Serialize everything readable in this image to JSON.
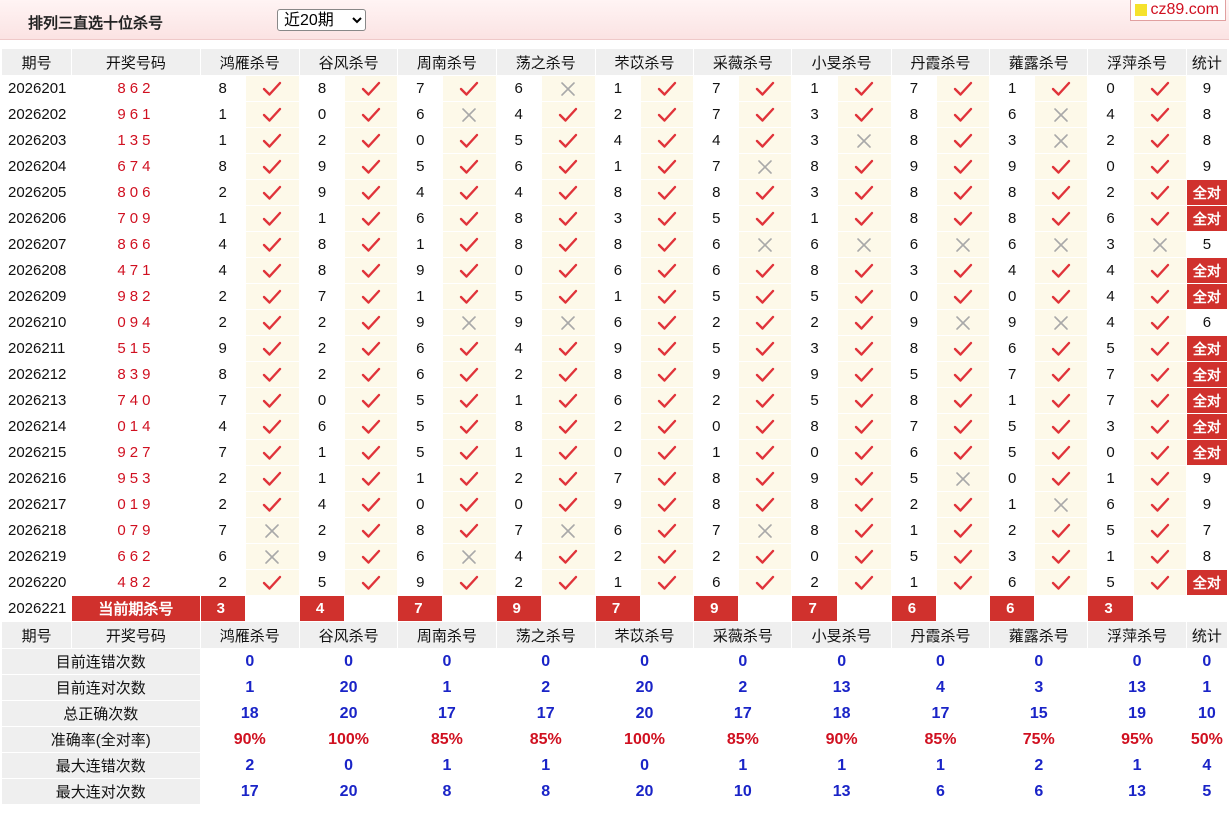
{
  "page": {
    "title": "排列三直选十位杀号",
    "period_selected": "近20期",
    "logo_text": "cz89.com"
  },
  "colors": {
    "accent": "#d0312d",
    "stat_blue": "#1a24c7",
    "stat_red": "#d01020",
    "mark_bg": "#fdf9e9"
  },
  "columns": {
    "issue": "期号",
    "draw": "开奖号码",
    "experts": [
      "鸿雁杀号",
      "谷风杀号",
      "周南杀号",
      "荡之杀号",
      "芣苡杀号",
      "采薇杀号",
      "小旻杀号",
      "丹霞杀号",
      "蕹露杀号",
      "浮萍杀号"
    ],
    "total": "统计"
  },
  "rows": [
    {
      "issue": "2026201",
      "draw": "862",
      "kills": [
        8,
        8,
        7,
        6,
        1,
        7,
        1,
        7,
        1,
        0
      ],
      "hits": [
        1,
        1,
        1,
        0,
        1,
        1,
        1,
        1,
        1,
        1
      ],
      "total": "9"
    },
    {
      "issue": "2026202",
      "draw": "961",
      "kills": [
        1,
        0,
        6,
        4,
        2,
        7,
        3,
        8,
        6,
        4
      ],
      "hits": [
        1,
        1,
        0,
        1,
        1,
        1,
        1,
        1,
        0,
        1
      ],
      "total": "8"
    },
    {
      "issue": "2026203",
      "draw": "135",
      "kills": [
        1,
        2,
        0,
        5,
        4,
        4,
        3,
        8,
        3,
        2
      ],
      "hits": [
        1,
        1,
        1,
        1,
        1,
        1,
        0,
        1,
        0,
        1
      ],
      "total": "8"
    },
    {
      "issue": "2026204",
      "draw": "674",
      "kills": [
        8,
        9,
        5,
        6,
        1,
        7,
        8,
        9,
        9,
        0
      ],
      "hits": [
        1,
        1,
        1,
        1,
        1,
        0,
        1,
        1,
        1,
        1
      ],
      "total": "9"
    },
    {
      "issue": "2026205",
      "draw": "806",
      "kills": [
        2,
        9,
        4,
        4,
        8,
        8,
        3,
        8,
        8,
        2
      ],
      "hits": [
        1,
        1,
        1,
        1,
        1,
        1,
        1,
        1,
        1,
        1
      ],
      "total": "全对"
    },
    {
      "issue": "2026206",
      "draw": "709",
      "kills": [
        1,
        1,
        6,
        8,
        3,
        5,
        1,
        8,
        8,
        6
      ],
      "hits": [
        1,
        1,
        1,
        1,
        1,
        1,
        1,
        1,
        1,
        1
      ],
      "total": "全对"
    },
    {
      "issue": "2026207",
      "draw": "866",
      "kills": [
        4,
        8,
        1,
        8,
        8,
        6,
        6,
        6,
        6,
        3
      ],
      "hits": [
        1,
        1,
        1,
        1,
        1,
        0,
        0,
        0,
        0,
        0
      ],
      "total": "5"
    },
    {
      "issue": "2026208",
      "draw": "471",
      "kills": [
        4,
        8,
        9,
        0,
        6,
        6,
        8,
        3,
        4,
        4
      ],
      "hits": [
        1,
        1,
        1,
        1,
        1,
        1,
        1,
        1,
        1,
        1
      ],
      "total": "全对"
    },
    {
      "issue": "2026209",
      "draw": "982",
      "kills": [
        2,
        7,
        1,
        5,
        1,
        5,
        5,
        0,
        0,
        4
      ],
      "hits": [
        1,
        1,
        1,
        1,
        1,
        1,
        1,
        1,
        1,
        1
      ],
      "total": "全对"
    },
    {
      "issue": "2026210",
      "draw": "094",
      "kills": [
        2,
        2,
        9,
        9,
        6,
        2,
        2,
        9,
        9,
        4
      ],
      "hits": [
        1,
        1,
        0,
        0,
        1,
        1,
        1,
        0,
        0,
        1
      ],
      "total": "6"
    },
    {
      "issue": "2026211",
      "draw": "515",
      "kills": [
        9,
        2,
        6,
        4,
        9,
        5,
        3,
        8,
        6,
        5
      ],
      "hits": [
        1,
        1,
        1,
        1,
        1,
        1,
        1,
        1,
        1,
        1
      ],
      "total": "全对"
    },
    {
      "issue": "2026212",
      "draw": "839",
      "kills": [
        8,
        2,
        6,
        2,
        8,
        9,
        9,
        5,
        7,
        7
      ],
      "hits": [
        1,
        1,
        1,
        1,
        1,
        1,
        1,
        1,
        1,
        1
      ],
      "total": "全对"
    },
    {
      "issue": "2026213",
      "draw": "740",
      "kills": [
        7,
        0,
        5,
        1,
        6,
        2,
        5,
        8,
        1,
        7
      ],
      "hits": [
        1,
        1,
        1,
        1,
        1,
        1,
        1,
        1,
        1,
        1
      ],
      "total": "全对"
    },
    {
      "issue": "2026214",
      "draw": "014",
      "kills": [
        4,
        6,
        5,
        8,
        2,
        0,
        8,
        7,
        5,
        3
      ],
      "hits": [
        1,
        1,
        1,
        1,
        1,
        1,
        1,
        1,
        1,
        1
      ],
      "total": "全对"
    },
    {
      "issue": "2026215",
      "draw": "927",
      "kills": [
        7,
        1,
        5,
        1,
        0,
        1,
        0,
        6,
        5,
        0
      ],
      "hits": [
        1,
        1,
        1,
        1,
        1,
        1,
        1,
        1,
        1,
        1
      ],
      "total": "全对"
    },
    {
      "issue": "2026216",
      "draw": "953",
      "kills": [
        2,
        1,
        1,
        2,
        7,
        8,
        9,
        5,
        0,
        1
      ],
      "hits": [
        1,
        1,
        1,
        1,
        1,
        1,
        1,
        0,
        1,
        1
      ],
      "total": "9"
    },
    {
      "issue": "2026217",
      "draw": "019",
      "kills": [
        2,
        4,
        0,
        0,
        9,
        8,
        8,
        2,
        1,
        6
      ],
      "hits": [
        1,
        1,
        1,
        1,
        1,
        1,
        1,
        1,
        0,
        1
      ],
      "total": "9"
    },
    {
      "issue": "2026218",
      "draw": "079",
      "kills": [
        7,
        2,
        8,
        7,
        6,
        7,
        8,
        1,
        2,
        5
      ],
      "hits": [
        0,
        1,
        1,
        0,
        1,
        0,
        1,
        1,
        1,
        1
      ],
      "total": "7"
    },
    {
      "issue": "2026219",
      "draw": "662",
      "kills": [
        6,
        9,
        6,
        4,
        2,
        2,
        0,
        5,
        3,
        1
      ],
      "hits": [
        0,
        1,
        0,
        1,
        1,
        1,
        1,
        1,
        1,
        1
      ],
      "total": "8"
    },
    {
      "issue": "2026220",
      "draw": "482",
      "kills": [
        2,
        5,
        9,
        2,
        1,
        6,
        2,
        1,
        6,
        5
      ],
      "hits": [
        1,
        1,
        1,
        1,
        1,
        1,
        1,
        1,
        1,
        1
      ],
      "total": "全对"
    }
  ],
  "current": {
    "issue": "2026221",
    "label": "当前期杀号",
    "kills": [
      3,
      4,
      7,
      9,
      7,
      9,
      7,
      6,
      6,
      3
    ]
  },
  "stats": [
    {
      "label": "目前连错次数",
      "values": [
        "0",
        "0",
        "0",
        "0",
        "0",
        "0",
        "0",
        "0",
        "0",
        "0"
      ],
      "total": "0",
      "style": "blue"
    },
    {
      "label": "目前连对次数",
      "values": [
        "1",
        "20",
        "1",
        "2",
        "20",
        "2",
        "13",
        "4",
        "3",
        "13"
      ],
      "total": "1",
      "style": "blue"
    },
    {
      "label": "总正确次数",
      "values": [
        "18",
        "20",
        "17",
        "17",
        "20",
        "17",
        "18",
        "17",
        "15",
        "19"
      ],
      "total": "10",
      "style": "blue"
    },
    {
      "label": "准确率(全对率)",
      "values": [
        "90%",
        "100%",
        "85%",
        "85%",
        "100%",
        "85%",
        "90%",
        "85%",
        "75%",
        "95%"
      ],
      "total": "50%",
      "style": "red"
    },
    {
      "label": "最大连错次数",
      "values": [
        "2",
        "0",
        "1",
        "1",
        "0",
        "1",
        "1",
        "1",
        "2",
        "1"
      ],
      "total": "4",
      "style": "blue"
    },
    {
      "label": "最大连对次数",
      "values": [
        "17",
        "20",
        "8",
        "8",
        "20",
        "10",
        "13",
        "6",
        "6",
        "13"
      ],
      "total": "5",
      "style": "blue"
    }
  ]
}
